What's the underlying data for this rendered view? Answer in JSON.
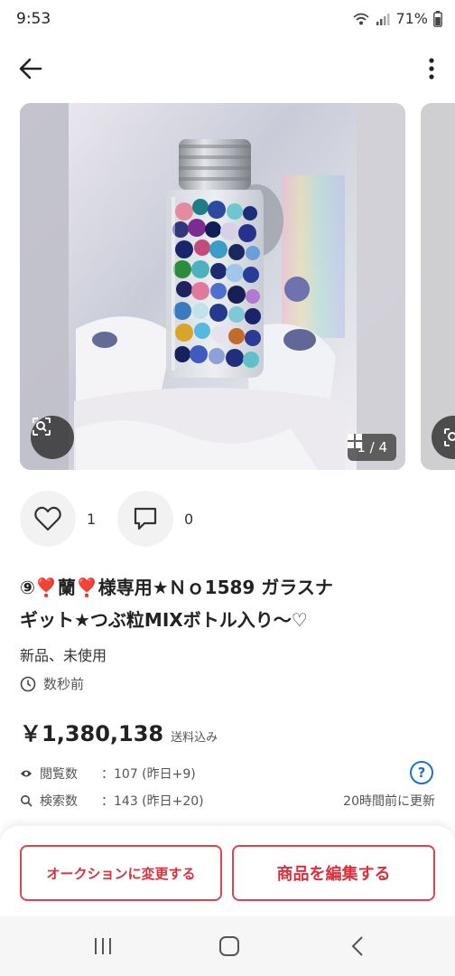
{
  "status_bar": {
    "time": "9:53",
    "battery": "71%"
  },
  "gallery": {
    "counter": "1 / 4"
  },
  "actions": {
    "like_count": "1",
    "comment_count": "0"
  },
  "item": {
    "title_line1": "⑨❣️蘭❣️様専用★Ｎｏ1589 ガラスナ",
    "title_line2": "ギット★つぶ粒MIXボトル入り〜♡",
    "condition": "新品、未使用",
    "posted": "数秒前",
    "price": "￥1,380,138",
    "shipping": "送料込み"
  },
  "stats": {
    "views_label": "閲覧数",
    "views_value": "：107 (昨日+9)",
    "search_label": "検索数",
    "search_value": "：143 (昨日+20)",
    "help": "?",
    "updated": "20時間前に更新"
  },
  "buttons": {
    "auction": "オークションに変更する",
    "edit": "商品を編集する"
  },
  "colors": {
    "accent": "#e0434f",
    "link": "#1a73c8"
  }
}
